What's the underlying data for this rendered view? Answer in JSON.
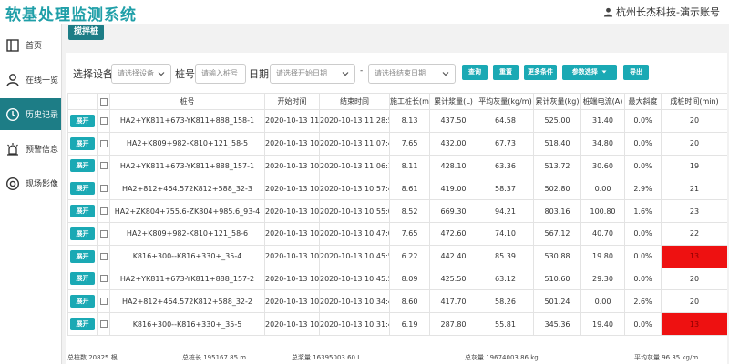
{
  "header": {
    "title": "软基处理监测系统",
    "user": "杭州长杰科技-演示账号"
  },
  "sidebar": {
    "items": [
      {
        "label": "首页",
        "icon": "home-icon"
      },
      {
        "label": "在线一览",
        "icon": "person-icon"
      },
      {
        "label": "历史记录",
        "icon": "clock-icon",
        "active": true
      },
      {
        "label": "预警信息",
        "icon": "alarm-icon"
      },
      {
        "label": "现场影像",
        "icon": "camera-icon"
      }
    ]
  },
  "tab": {
    "label": "搅拌桩"
  },
  "filter": {
    "device_label": "选择设备",
    "device_placeholder": "请选择设备",
    "pile_label": "桩号",
    "pile_placeholder": "请输入桩号",
    "date_label": "日期",
    "start_placeholder": "请选择开始日期",
    "date_sep": "-",
    "end_placeholder": "请选择结束日期",
    "buttons": {
      "query": "查询",
      "reset": "重置",
      "more": "更多条件",
      "params": "参数选择",
      "export": "导出"
    }
  },
  "table": {
    "columns": [
      "",
      "",
      "桩号",
      "开始时间",
      "结束时间",
      "施工桩长(m)",
      "累计浆量(L)",
      "平均灰量(kg/m)",
      "累计灰量(kg)",
      "桩端电流(A)",
      "最大斜度",
      "成桩时间(min)"
    ],
    "expand_label": "展开",
    "rows": [
      {
        "pile": "HA2+YK811+673-YK811+888_158-1",
        "start": "2020-10-13 11:08:33",
        "end": "2020-10-13 11:28:57",
        "length": "8.13",
        "slurry": "437.50",
        "avg_ash": "64.58",
        "total_ash": "525.00",
        "current": "31.40",
        "slope": "0.0%",
        "duration": "20",
        "alert": false
      },
      {
        "pile": "HA2+K809+982-K810+121_58-5",
        "start": "2020-10-13 10:47:13",
        "end": "2020-10-13 11:07:46",
        "length": "7.65",
        "slurry": "432.00",
        "avg_ash": "67.73",
        "total_ash": "518.40",
        "current": "34.80",
        "slope": "0.0%",
        "duration": "20",
        "alert": false
      },
      {
        "pile": "HA2+YK811+673-YK811+888_157-1",
        "start": "2020-10-13 10:46:43",
        "end": "2020-10-13 11:06:15",
        "length": "8.11",
        "slurry": "428.10",
        "avg_ash": "63.36",
        "total_ash": "513.72",
        "current": "30.60",
        "slope": "0.0%",
        "duration": "19",
        "alert": false
      },
      {
        "pile": "HA2+812+464.572K812+588_32-3",
        "start": "2020-10-13 10:35:54",
        "end": "2020-10-13 10:57:48",
        "length": "8.61",
        "slurry": "419.00",
        "avg_ash": "58.37",
        "total_ash": "502.80",
        "current": "0.00",
        "slope": "2.9%",
        "duration": "21",
        "alert": false
      },
      {
        "pile": "HA2+ZK804+755.6-ZK804+985.6_93-4",
        "start": "2020-10-13 10:31:21",
        "end": "2020-10-13 10:55:02",
        "length": "8.52",
        "slurry": "669.30",
        "avg_ash": "94.21",
        "total_ash": "803.16",
        "current": "100.80",
        "slope": "1.6%",
        "duration": "23",
        "alert": false
      },
      {
        "pile": "HA2+K809+982-K810+121_58-6",
        "start": "2020-10-13 10:24:20",
        "end": "2020-10-13 10:47:00",
        "length": "7.65",
        "slurry": "472.60",
        "avg_ash": "74.10",
        "total_ash": "567.12",
        "current": "40.70",
        "slope": "0.0%",
        "duration": "22",
        "alert": false
      },
      {
        "pile": "K816+300--K816+330+_35-4",
        "start": "2020-10-13 10:31:58",
        "end": "2020-10-13 10:45:52",
        "length": "6.22",
        "slurry": "442.40",
        "avg_ash": "85.39",
        "total_ash": "530.88",
        "current": "19.80",
        "slope": "0.0%",
        "duration": "13",
        "alert": true
      },
      {
        "pile": "HA2+YK811+673-YK811+888_157-2",
        "start": "2020-10-13 10:25:55",
        "end": "2020-10-13 10:45:58",
        "length": "8.09",
        "slurry": "425.50",
        "avg_ash": "63.12",
        "total_ash": "510.60",
        "current": "29.30",
        "slope": "0.0%",
        "duration": "20",
        "alert": false
      },
      {
        "pile": "HA2+812+464.572K812+588_32-2",
        "start": "2020-10-13 10:13:55",
        "end": "2020-10-13 10:34:47",
        "length": "8.60",
        "slurry": "417.70",
        "avg_ash": "58.26",
        "total_ash": "501.24",
        "current": "0.00",
        "slope": "2.6%",
        "duration": "20",
        "alert": false
      },
      {
        "pile": "K816+300--K816+330+_35-5",
        "start": "2020-10-13 10:17:51",
        "end": "2020-10-13 10:31:48",
        "length": "6.19",
        "slurry": "287.80",
        "avg_ash": "55.81",
        "total_ash": "345.36",
        "current": "19.40",
        "slope": "0.0%",
        "duration": "13",
        "alert": true
      }
    ]
  },
  "footer": {
    "total_piles": "总桩数 20825 根",
    "total_length": "总桩长 195167.85 m",
    "total_slurry": "总浆量 16395003.60 L",
    "total_ash": "总灰量 19674003.86 kg",
    "avg_ash": "平均灰量 96.35 kg/m"
  },
  "colors": {
    "accent": "#1aa9b4",
    "dark_accent": "#1d7d86",
    "alert": "#ee1111"
  }
}
